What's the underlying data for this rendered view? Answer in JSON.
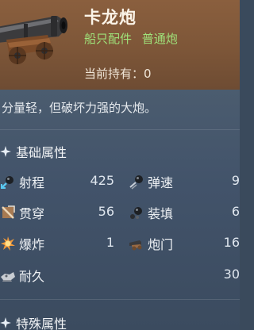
{
  "item": {
    "name": "卡龙炮",
    "tags": [
      "船只配件",
      "普通炮"
    ],
    "owned_label": "当前持有：0"
  },
  "description": "分量轻，但破坏力强的大炮。",
  "basic_section": {
    "title": "基础属性",
    "stats": [
      {
        "label": "射程",
        "value": "425",
        "icon": "range-icon"
      },
      {
        "label": "弹速",
        "value": "9",
        "icon": "shell-speed-icon"
      },
      {
        "label": "贯穿",
        "value": "56",
        "icon": "penetration-icon"
      },
      {
        "label": "装填",
        "value": "6",
        "icon": "reload-icon"
      },
      {
        "label": "爆炸",
        "value": "1",
        "icon": "explosion-icon"
      },
      {
        "label": "炮门",
        "value": "16",
        "icon": "gun-port-icon"
      },
      {
        "label": "耐久",
        "value": "30",
        "icon": "durability-icon"
      }
    ]
  },
  "special_section": {
    "title": "特殊属性"
  },
  "colors": {
    "header_bg": "#7d5638",
    "body_bg": "#42536a",
    "tag_green": "#9fe27a",
    "stat_value": "#dfe6ee"
  }
}
